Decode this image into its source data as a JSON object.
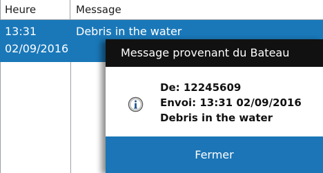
{
  "table": {
    "headers": {
      "time": "Heure",
      "message": "Message"
    },
    "rows": [
      {
        "time": "13:31",
        "date": "02/09/2016",
        "message": "Debris in the water"
      }
    ]
  },
  "dialog": {
    "title": "Message provenant du Bateau",
    "icon": "info-icon",
    "from": "De: 12245609",
    "sent": "Envoi: 13:31 02/09/2016",
    "body": "Debris in the water",
    "close_label": "Fermer"
  },
  "colors": {
    "selection": "#1a78b9",
    "dialog_header": "#111111",
    "button": "#1b75b6"
  }
}
